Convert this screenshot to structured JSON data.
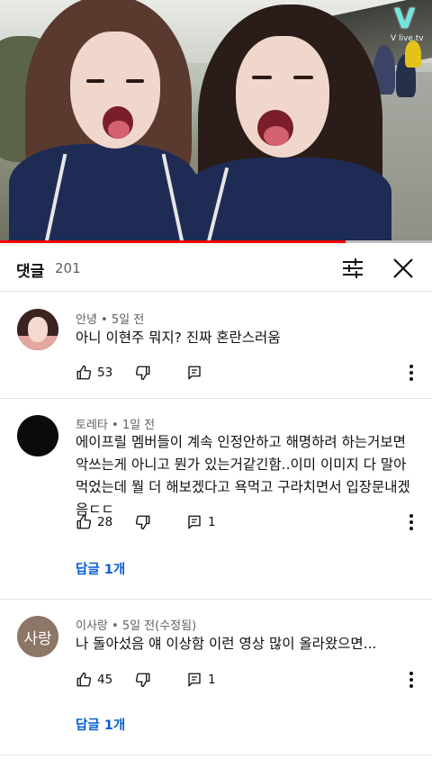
{
  "video": {
    "watermark": "V",
    "watermark_sub": "V live.tv",
    "progress": 0.8
  },
  "header": {
    "title": "댓글",
    "count": "201",
    "sort_icon": "sort-filter-icon",
    "close_icon": "close-icon"
  },
  "comments": [
    {
      "author": "안녕",
      "time": "5일 전",
      "meta": "안녕 • 5일 전",
      "text": "아니 이현주 뭐지? 진짜 혼란스러움",
      "likes": "53",
      "reply_count": "",
      "replies_label": ""
    },
    {
      "author": "토레타",
      "time": "1일 전",
      "meta": "토레타 • 1일 전",
      "text": "에이프릴 멤버들이 계속 인정안하고 해명하려 하는거보면 악쓰는게 아니고 뭔가 있는거같긴함..이미 이미지 다 말아먹었는데 뭘 더 해보겠다고 욕먹고 구라치면서 입장문내겠음ㄷㄷ",
      "likes": "28",
      "reply_count": "1",
      "replies_label": "답글 1개"
    },
    {
      "author": "이사랑",
      "avatar_text": "사랑",
      "time": "5일 전(수정됨)",
      "meta": "이사랑 • 5일 전(수정됨)",
      "text": "나 돌아섰음 얘 이상함 이런 영상 많이 올라왔으면...",
      "likes": "45",
      "reply_count": "1",
      "replies_label": "답글 1개"
    }
  ],
  "colors": {
    "link": "#065fd4",
    "progress": "#ff0000",
    "meta": "#606060"
  }
}
